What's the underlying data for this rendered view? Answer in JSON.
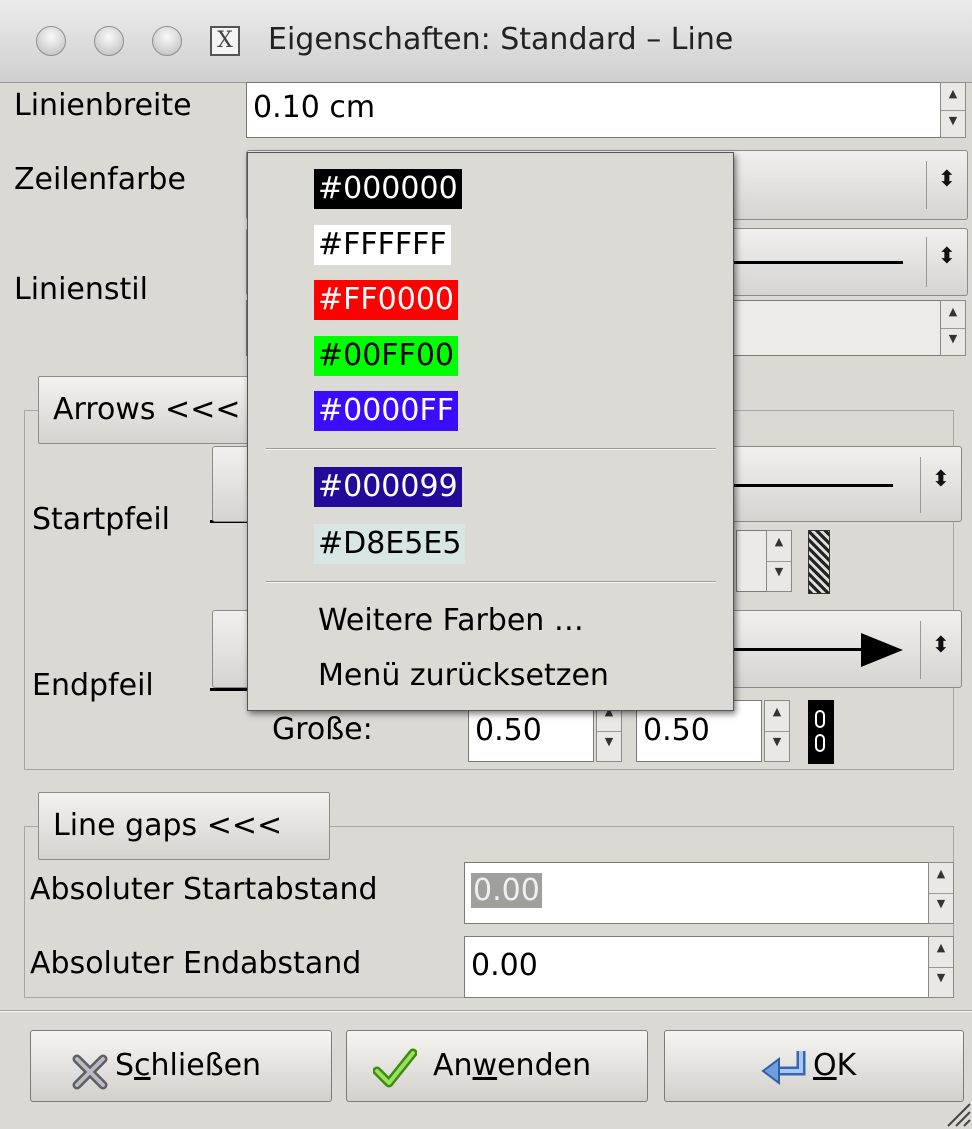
{
  "window": {
    "title": "Eigenschaften: Standard – Line",
    "x_icon_glyph": "X"
  },
  "form": {
    "linienbreite_label": "Linienbreite",
    "linienbreite_value": "0.10 cm",
    "zeilenfarbe_label": "Zeilenfarbe",
    "linienstil_label": "Linienstil"
  },
  "arrows": {
    "toggle_label": "Arrows <<<",
    "startpfeil_label": "Startpfeil",
    "endpfeil_label": "Endpfeil",
    "grosse_label": "Große:",
    "grosse_value_1": "0.50",
    "grosse_value_2": "0.50"
  },
  "line_gaps": {
    "toggle_label": "Line gaps <<<",
    "start_label": "Absoluter Startabstand",
    "start_value": "0.00",
    "end_label": "Absoluter Endabstand",
    "end_value": "0.00"
  },
  "color_menu": {
    "colors": [
      {
        "label": "#000000",
        "bg": "#000000",
        "fg": "#ffffff"
      },
      {
        "label": "#FFFFFF",
        "bg": "#ffffff",
        "fg": "#000000"
      },
      {
        "label": "#FF0000",
        "bg": "#ff0000",
        "fg": "#ffffff"
      },
      {
        "label": "#00FF00",
        "bg": "#00ff00",
        "fg": "#000000"
      },
      {
        "label": "#0000FF",
        "bg": "#3a0dff",
        "fg": "#ffffff"
      }
    ],
    "recent_colors": [
      {
        "label": "#000099",
        "bg": "#230a99",
        "fg": "#ffffff"
      },
      {
        "label": "#D8E5E5",
        "bg": "#d8e5e5",
        "fg": "#000000"
      }
    ],
    "more_colors_label": "Weitere Farben …",
    "reset_menu_label": "Menü zurücksetzen"
  },
  "buttons": {
    "close_pre": "S",
    "close_mn": "c",
    "close_post": "hließen",
    "apply_pre": "An",
    "apply_mn": "w",
    "apply_post": "enden",
    "ok_pre": "",
    "ok_mn": "O",
    "ok_post": "K"
  },
  "icons": {
    "close": "close-x-icon",
    "apply": "checkmark-icon",
    "ok": "return-arrow-icon",
    "chain": "chain-link-icon",
    "resize": "resize-grip-icon"
  }
}
